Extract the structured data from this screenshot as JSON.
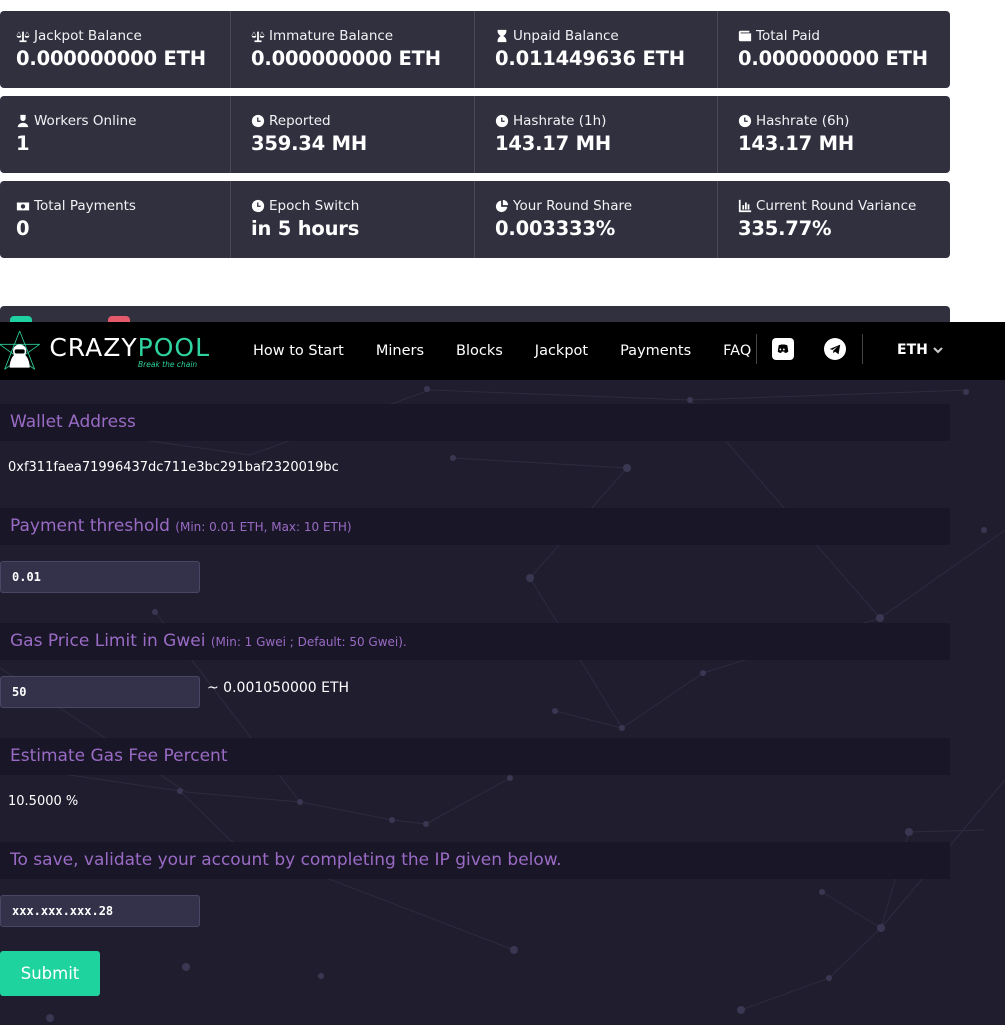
{
  "stats": [
    [
      {
        "icon": "scale-icon",
        "label": "Jackpot Balance",
        "value": "0.000000000 ETH"
      },
      {
        "icon": "scale-icon",
        "label": "Immature Balance",
        "value": "0.000000000 ETH"
      },
      {
        "icon": "hourglass-icon",
        "label": "Unpaid Balance",
        "value": "0.011449636 ETH"
      },
      {
        "icon": "wallet-icon",
        "label": "Total Paid",
        "value": "0.000000000 ETH"
      }
    ],
    [
      {
        "icon": "worker-icon",
        "label": "Workers Online",
        "value": "1"
      },
      {
        "icon": "clock-icon",
        "label": "Reported",
        "value": "359.34 MH"
      },
      {
        "icon": "clock-icon",
        "label": "Hashrate (1h)",
        "value": "143.17 MH"
      },
      {
        "icon": "clock-icon",
        "label": "Hashrate (6h)",
        "value": "143.17 MH"
      }
    ],
    [
      {
        "icon": "money-icon",
        "label": "Total Payments",
        "value": "0"
      },
      {
        "icon": "clock-icon",
        "label": "Epoch Switch",
        "value": "in 5 hours"
      },
      {
        "icon": "pie-chart-icon",
        "label": "Your Round Share",
        "value": "0.003333%"
      },
      {
        "icon": "bar-chart-icon",
        "label": "Current Round Variance",
        "value": "335.77%"
      }
    ]
  ],
  "navbar": {
    "logo_main": "CRAZY",
    "logo_pool": "POOL",
    "logo_tagline": "Break the chain",
    "links": [
      "How to Start",
      "Miners",
      "Blocks",
      "Jackpot",
      "Payments",
      "FAQ"
    ],
    "coin": "ETH"
  },
  "settings": {
    "wallet": {
      "title": "Wallet Address",
      "value": "0xf311faea71996437dc711e3bc291baf2320019bc"
    },
    "threshold": {
      "title": "Payment threshold",
      "hint": "(Min: 0.01 ETH, Max: 10 ETH)",
      "value": "0.01"
    },
    "gas": {
      "title": "Gas Price Limit in Gwei",
      "hint": "(Min: 1 Gwei ; Default: 50 Gwei).",
      "value": "50",
      "estimate": "~ 0.001050000 ETH"
    },
    "fee": {
      "title": "Estimate Gas Fee Percent",
      "value": "10.5000 %"
    },
    "validate": {
      "title": "To save, validate your account by completing the IP given below.",
      "value": "xxx.xxx.xxx.28"
    },
    "submit_label": "Submit"
  },
  "colors": {
    "panel": "#31303f",
    "accent": "#1fd39f",
    "heading": "#9a6bc4",
    "settings_bg": "#201d2f"
  }
}
